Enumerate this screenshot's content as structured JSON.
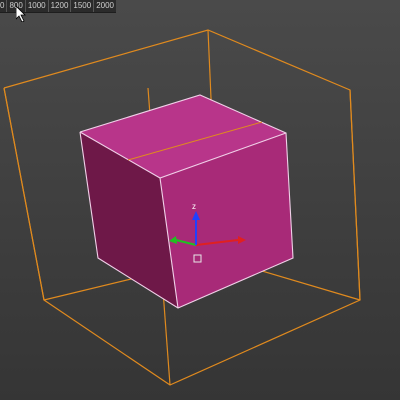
{
  "viewport": {
    "ruler_ticks": [
      "0",
      "800",
      "1000",
      "1200",
      "1500",
      "2000"
    ]
  },
  "colors": {
    "background_top": "#4a4a4a",
    "background_bottom": "#353535",
    "cube_front": "#a82a78",
    "cube_top": "#b8358a",
    "cube_side": "#6e1848",
    "cube_edge": "#f0d0e8",
    "bounding_box": "#e08a1e",
    "gizmo_x": "#e02020",
    "gizmo_y": "#20c020",
    "gizmo_z": "#2040ff"
  },
  "gizmo": {
    "z_label": "z"
  },
  "icons": {
    "cursor": "mouse-pointer-icon",
    "gizmo": "move-gizmo-icon"
  }
}
